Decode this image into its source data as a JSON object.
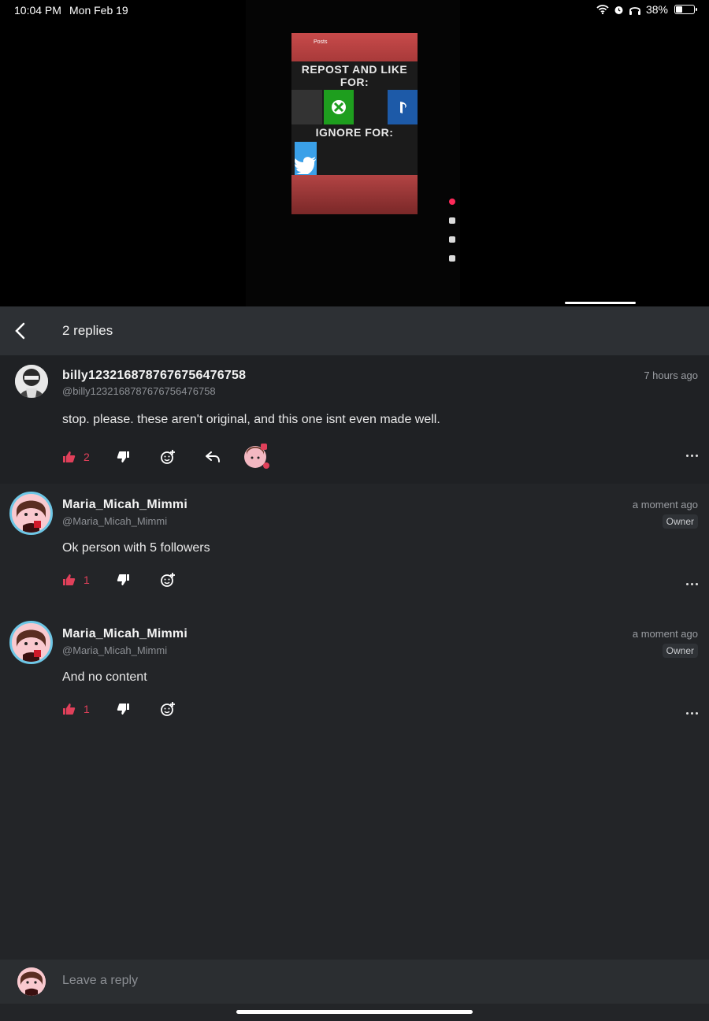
{
  "status_bar": {
    "time": "10:04 PM",
    "date": "Mon Feb 19",
    "battery": "38%",
    "battery_level": 0.38
  },
  "media": {
    "post_title": "Posts",
    "headline_top": "REPOST AND LIKE FOR:",
    "headline_bottom": "IGNORE FOR:"
  },
  "header": {
    "title": "2 replies"
  },
  "comments": [
    {
      "username": "billy1232168787676756476758",
      "handle": "@billy1232168787676756476758",
      "time": "7 hours ago",
      "text": "stop. please. these aren't original, and this one isnt even made well.",
      "likes": "2"
    },
    {
      "username": "Maria_Micah_Mimmi",
      "handle": "@Maria_Micah_Mimmi",
      "time": "a moment ago",
      "badge": "Owner",
      "text": "Ok person with 5 followers",
      "likes": "1"
    },
    {
      "username": "Maria_Micah_Mimmi",
      "handle": "@Maria_Micah_Mimmi",
      "time": "a moment ago",
      "badge": "Owner",
      "text": "And no content",
      "likes": "1"
    }
  ],
  "reply_input": {
    "placeholder": "Leave a reply"
  },
  "colors": {
    "accent_like": "#e0405a",
    "header_bg": "#2d3034",
    "list_bg": "#232528"
  }
}
